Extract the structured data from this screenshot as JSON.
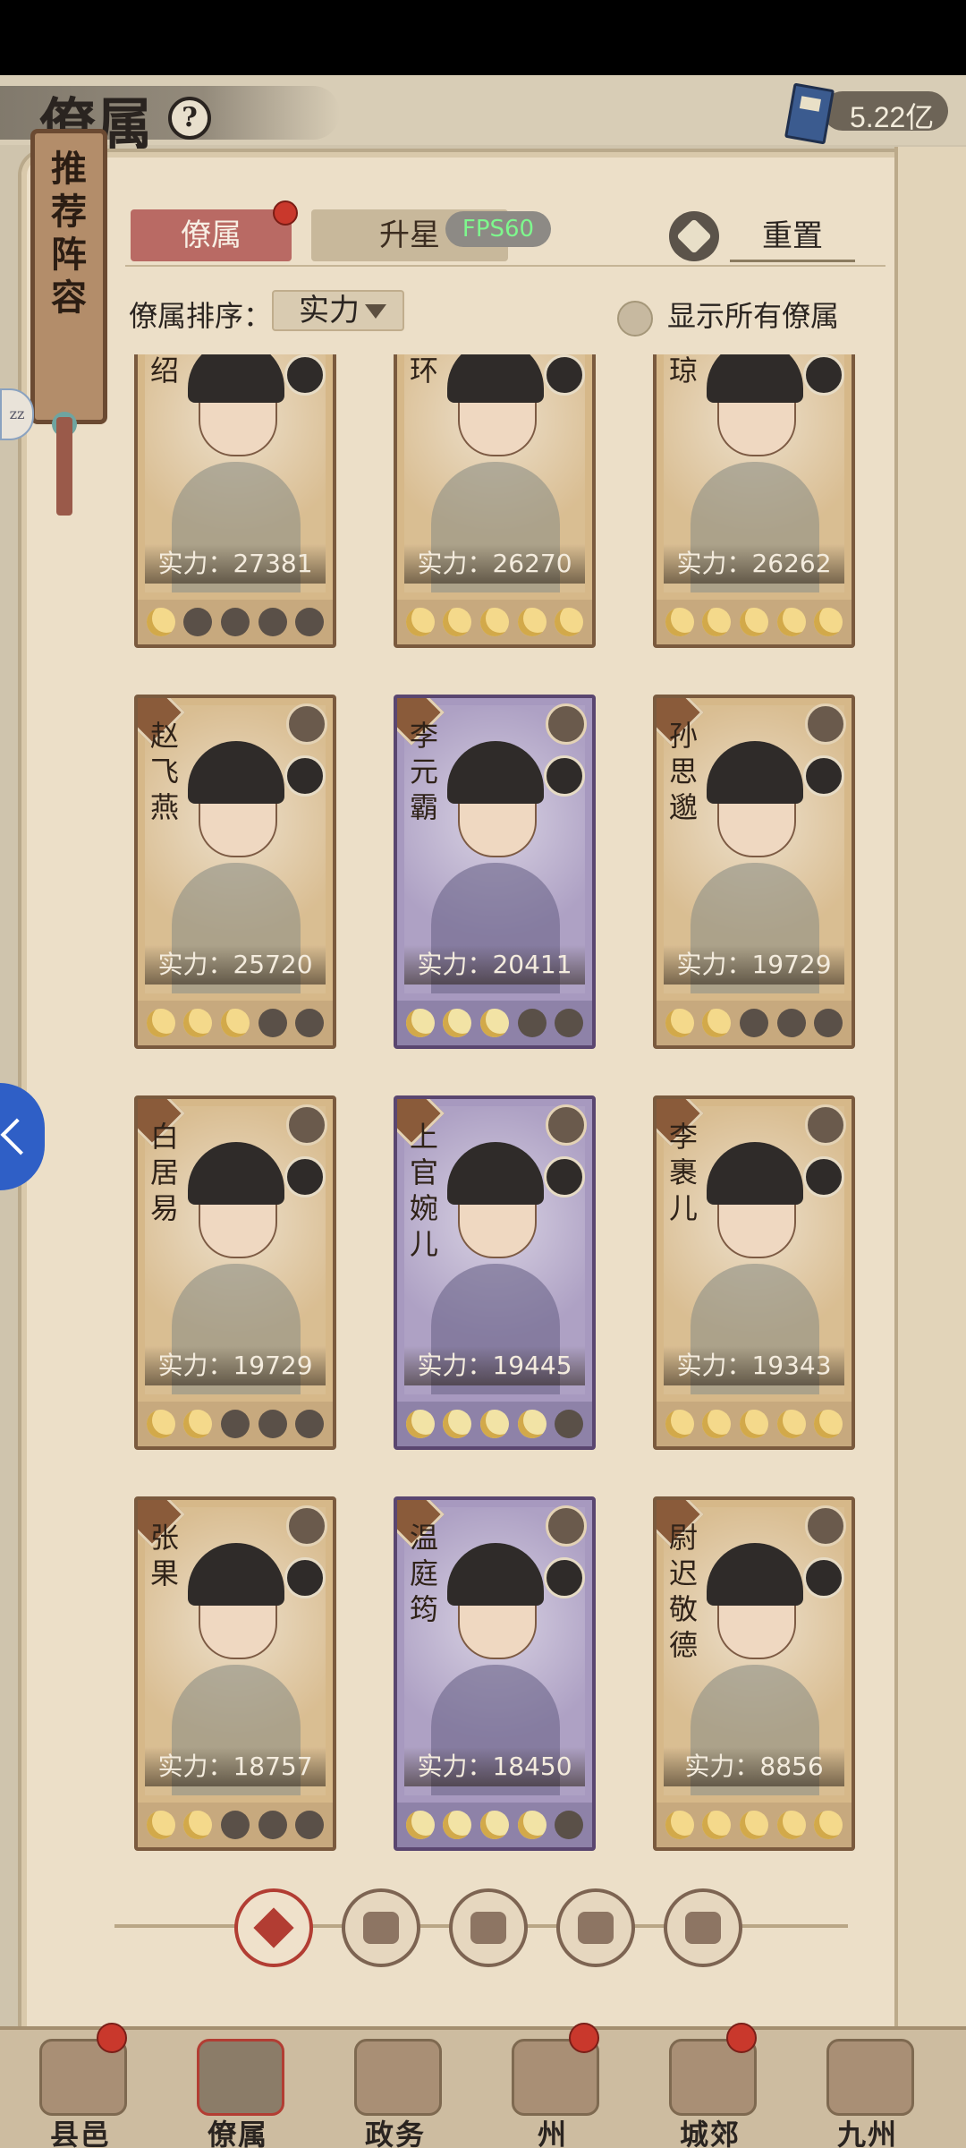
{
  "header": {
    "title": "僚属",
    "help_symbol": "?",
    "currency_value": "5.22亿"
  },
  "side_scroll": {
    "label": "推荐阵容"
  },
  "side_bubble": "zz",
  "tabs": [
    {
      "label": "僚属",
      "active": true,
      "has_dot": true
    },
    {
      "label": "升星",
      "active": false,
      "has_dot": false
    }
  ],
  "fps_overlay": "FPS60",
  "reset_label": "重置",
  "sort": {
    "label": "僚属排序：",
    "value": "实力"
  },
  "show_all_label": "显示所有僚属",
  "power_prefix": "实力：",
  "cards": [
    {
      "name": "柴绍",
      "power": "27381",
      "stars_on": 1,
      "theme": "gold"
    },
    {
      "name": "瑶环",
      "power": "26270",
      "stars_on": 5,
      "theme": "gold"
    },
    {
      "name": "秦琼",
      "power": "26262",
      "stars_on": 5,
      "theme": "gold"
    },
    {
      "name": "赵飞燕",
      "power": "25720",
      "stars_on": 3,
      "theme": "gold"
    },
    {
      "name": "李元霸",
      "power": "20411",
      "stars_on": 3,
      "theme": "purple"
    },
    {
      "name": "孙思邈",
      "power": "19729",
      "stars_on": 2,
      "theme": "gold"
    },
    {
      "name": "白居易",
      "power": "19729",
      "stars_on": 2,
      "theme": "gold"
    },
    {
      "name": "上官婉儿",
      "power": "19445",
      "stars_on": 4,
      "theme": "purple"
    },
    {
      "name": "李裹儿",
      "power": "19343",
      "stars_on": 5,
      "theme": "gold"
    },
    {
      "name": "张果",
      "power": "18757",
      "stars_on": 2,
      "theme": "gold"
    },
    {
      "name": "温庭筠",
      "power": "18450",
      "stars_on": 4,
      "theme": "purple"
    },
    {
      "name": "尉迟敬德",
      "power": "8856",
      "stars_on": 5,
      "theme": "gold"
    }
  ],
  "category_filters": [
    {
      "name": "all",
      "active": true
    },
    {
      "name": "helmet",
      "active": false
    },
    {
      "name": "fan-beast",
      "active": false
    },
    {
      "name": "folding-fan",
      "active": false
    },
    {
      "name": "lion",
      "active": false
    }
  ],
  "bottom_nav": [
    {
      "label": "县邑",
      "has_dot": true,
      "active": false
    },
    {
      "label": "僚属",
      "has_dot": false,
      "active": true
    },
    {
      "label": "政务",
      "has_dot": false,
      "active": false
    },
    {
      "label": "州",
      "has_dot": true,
      "active": false
    },
    {
      "label": "城郊",
      "has_dot": true,
      "active": false
    },
    {
      "label": "九州",
      "has_dot": false,
      "active": false
    }
  ]
}
